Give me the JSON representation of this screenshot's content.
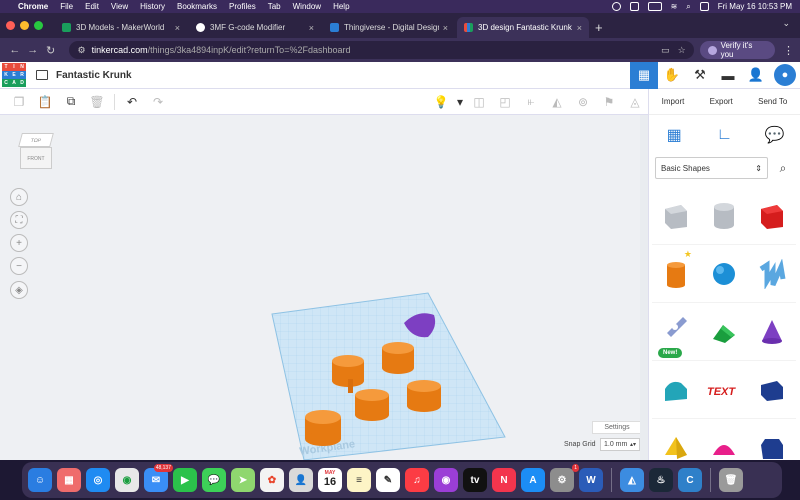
{
  "menubar": {
    "app": "Chrome",
    "items": [
      "File",
      "Edit",
      "View",
      "History",
      "Bookmarks",
      "Profiles",
      "Tab",
      "Window",
      "Help"
    ],
    "clock": "Fri May 16  10:53 PM"
  },
  "tabs": [
    {
      "title": "3D Models - MakerWorld",
      "color": "#1a9e5c"
    },
    {
      "title": "3MF G-code Modifier",
      "color": "#222222"
    },
    {
      "title": "Thingiverse - Digital Designs",
      "color": "#2b7ed4"
    },
    {
      "title": "3D design Fantastic Krunk - Tin",
      "color": "#e84c3d"
    }
  ],
  "address": {
    "domain": "tinkercad.com",
    "path": "/things/3ka4894inpK/edit?returnTo=%2Fdashboard",
    "verify_label": "Verify it's you"
  },
  "app": {
    "logo_letters": [
      "TIN",
      "KER",
      "CAD"
    ],
    "design_title": "Fantastic Krunk"
  },
  "viewcube": {
    "top": "TOP",
    "front": "FRONT"
  },
  "workplane": {
    "watermark": "Workplane",
    "settings_label": "Settings",
    "snap_label": "Snap Grid",
    "snap_value": "1.0 mm"
  },
  "panel": {
    "import_label": "Import",
    "export_label": "Export",
    "sendto_label": "Send To",
    "library": "Basic Shapes",
    "new_badge": "New!",
    "text_shape": "TEXT"
  },
  "dock": {
    "mail_badge": "48,137",
    "calendar_month": "MAY",
    "calendar_day": "16",
    "appstore_badge": "1",
    "tv_label": "tv",
    "word_label": "W"
  },
  "colors": {
    "accent": "#2b7ed4",
    "orange": "#f08a1c",
    "purple": "#7d3fc2",
    "workplane": "#cfe6f6"
  }
}
